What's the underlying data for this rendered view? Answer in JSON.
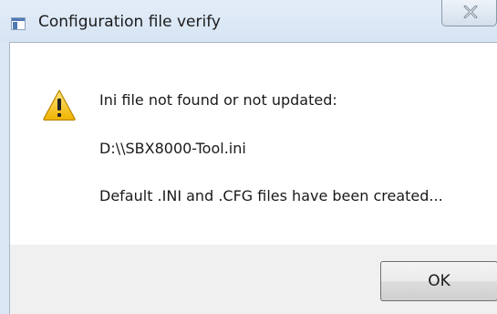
{
  "window": {
    "title": "Configuration file verify",
    "title_icon": "application-window-icon",
    "close_icon": "close-icon"
  },
  "message": {
    "icon": "warning-icon",
    "line1": "Ini file not found or not updated:",
    "line2": "D:\\\\SBX8000-Tool.ini",
    "line3": "Default .INI and .CFG files have been created..."
  },
  "buttons": {
    "ok_label": "OK"
  },
  "colors": {
    "titlebar": "#dbe7f4",
    "content_bg": "#ffffff",
    "footer_bg": "#f0f0f0",
    "warning_yellow": "#f3c21b"
  }
}
